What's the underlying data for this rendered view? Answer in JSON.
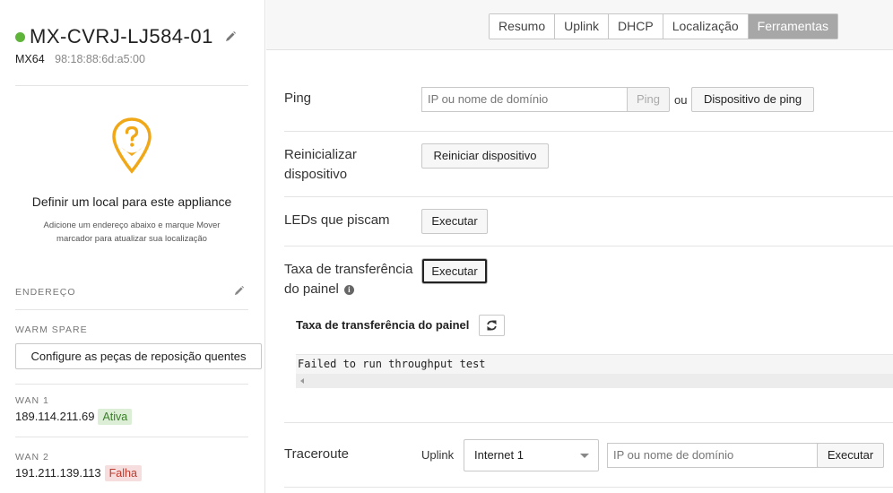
{
  "device": {
    "name": "MX-CVRJ-LJ584-01",
    "model": "MX64",
    "mac": "98:18:88:6d:a5:00",
    "status_color": "#5fb43a"
  },
  "location": {
    "title": "Definir um local para este appliance",
    "description": "Adicione um endereço abaixo e marque Mover marcador para atualizar sua localização",
    "icon": "map-pin-question-icon"
  },
  "sidebar": {
    "address_label": "ENDEREÇO",
    "warm_spare_label": "WARM SPARE",
    "warm_spare_button": "Configure as peças de reposição quentes",
    "wan1": {
      "label": "WAN 1",
      "ip": "189.114.211.69",
      "status": "Ativa"
    },
    "wan2": {
      "label": "WAN 2",
      "ip": "191.211.139.113",
      "status": "Falha"
    }
  },
  "tabs": [
    {
      "label": "Resumo",
      "active": false
    },
    {
      "label": "Uplink",
      "active": false
    },
    {
      "label": "DHCP",
      "active": false
    },
    {
      "label": "Localização",
      "active": false
    },
    {
      "label": "Ferramentas",
      "active": true
    }
  ],
  "tools": {
    "ping": {
      "label": "Ping",
      "placeholder": "IP ou nome de domínio",
      "button": "Ping",
      "or": "ou",
      "device_button": "Dispositivo de ping"
    },
    "reboot": {
      "label_line1": "Reinicializar",
      "label_line2": "dispositivo",
      "button": "Reiniciar dispositivo"
    },
    "leds": {
      "label": "LEDs que piscam",
      "button": "Executar"
    },
    "throughput": {
      "label_line1": "Taxa de transferência",
      "label_line2": "do painel",
      "button": "Executar",
      "panel_title": "Taxa de transferência do painel",
      "output": "Failed to run throughput test"
    },
    "traceroute": {
      "label": "Traceroute",
      "uplink_label": "Uplink",
      "uplink_value": "Internet 1",
      "placeholder": "IP ou nome de domínio",
      "button": "Executar"
    }
  },
  "colors": {
    "active_badge_bg": "#dcefd6",
    "fail_badge_bg": "#f6dede",
    "active_tab_bg": "#a7a7a7",
    "pin_color": "#f0a818"
  }
}
